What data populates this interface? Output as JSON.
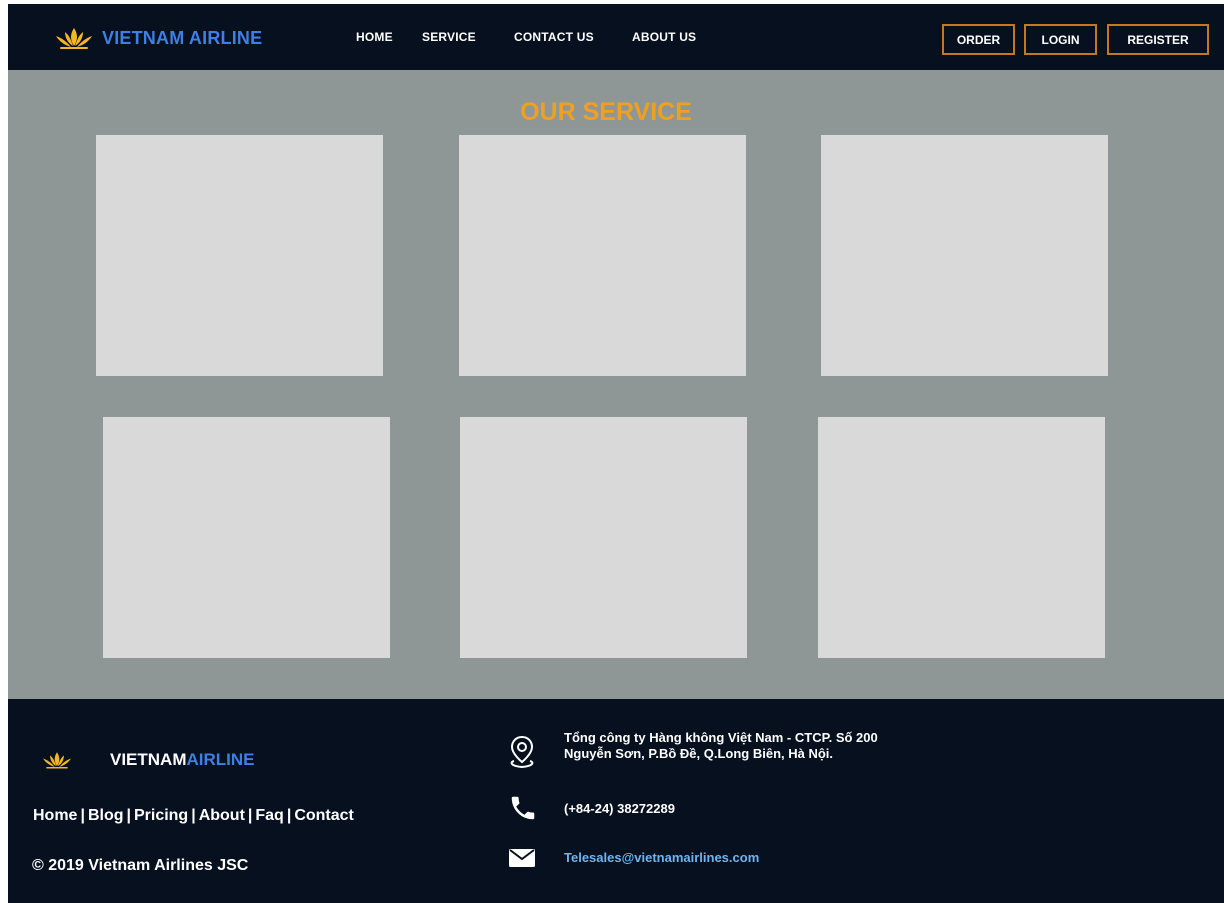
{
  "header": {
    "brand": "VIETNAM AIRLINE",
    "nav": [
      "HOME",
      "SERVICE",
      "CONTACT US",
      "ABOUT US"
    ],
    "buttons": {
      "order": "ORDER",
      "login": "LOGIN",
      "register": "REGISTER"
    }
  },
  "main": {
    "title": "OUR SERVICE",
    "cards": 6
  },
  "footer": {
    "brand_part1": "VIETNAM",
    "brand_part2": "AIRLINE",
    "links": [
      "Home",
      "Blog",
      "Pricing",
      "About",
      "Faq",
      "Contact"
    ],
    "separator": "|",
    "copyright": "© 2019 Vietnam Airlines JSC",
    "address": "Tổng công ty Hàng không Việt Nam - CTCP. Số 200 Nguyễn Sơn, P.Bồ Đề, Q.Long Biên, Hà Nội.",
    "phone": "(+84-24) 38272289",
    "email": "Telesales@vietnamairlines.com"
  },
  "colors": {
    "header_bg": "#06101f",
    "page_bg": "#8e9795",
    "card_bg": "#d9d9d9",
    "accent_orange": "#f0a020",
    "button_border": "#c8781c",
    "brand_blue": "#3f7fe3",
    "email_blue": "#6fb4f0"
  },
  "icons": {
    "logo": "lotus-logo-icon",
    "address": "location-pin-icon",
    "phone": "phone-icon",
    "email": "envelope-icon"
  }
}
